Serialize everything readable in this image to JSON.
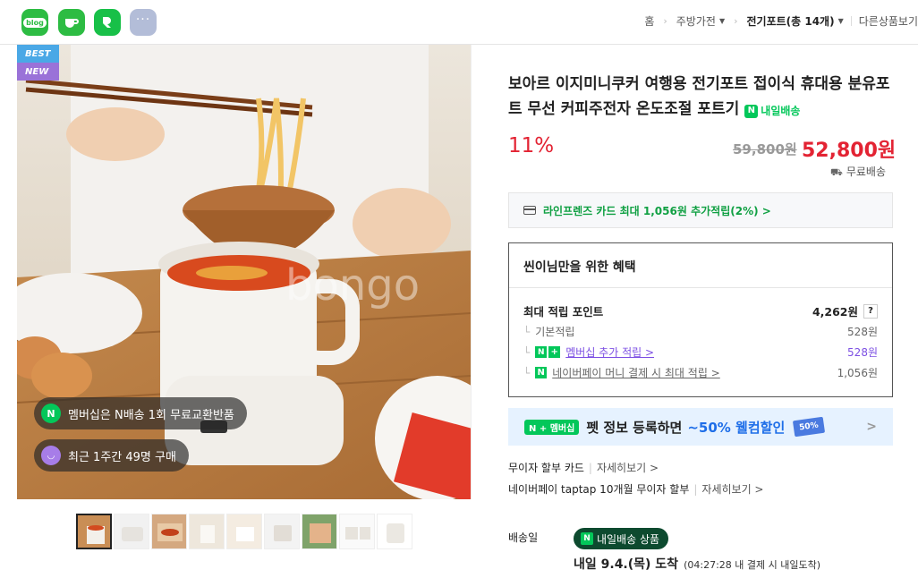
{
  "share": {
    "blog_label": "blog",
    "icons": [
      "blog-icon",
      "cafe-icon",
      "band-icon",
      "more-icon"
    ],
    "more_label": "···"
  },
  "breadcrumb": {
    "home": "홈",
    "category": "주방가전",
    "current": "전기포트(총 14개)",
    "other": "다른상품보기"
  },
  "image": {
    "badges": [
      "BEST",
      "NEW"
    ],
    "pill_membership": "멤버십은 N배송 1회 무료교환반품",
    "pill_recent": "최근 1주간 49명 구매",
    "pill_membership_icon": "N",
    "thumbnail_count": 9
  },
  "product": {
    "title": "보아르 이지미니쿠커 여행용 전기포트 접이식 휴대용 분유포트 무선 커피주전자 온도조절 포트기",
    "delivery_tag": "내일배송",
    "discount": "11%",
    "original_price": "59,800원",
    "price": "52,800원",
    "shipping": "무료배송"
  },
  "card_promo": "라인프렌즈 카드 최대 1,056원 추가적립(2%) >",
  "benefit": {
    "heading": "씬이님만을 위한 혜택",
    "max_points_label": "최대 적립 포인트",
    "max_points_value": "4,262원",
    "help": "?",
    "rows": [
      {
        "label": "기본적립",
        "value": "528원"
      },
      {
        "label": "멤버십 추가 적립 >",
        "value": "528원"
      },
      {
        "label": "네이버페이 머니 결제 시 최대 적립 >",
        "value": "1,056원"
      }
    ]
  },
  "banner": {
    "tag": "N + 멤버십",
    "text": "펫 정보 등록하면",
    "highlight": "~50% 웰컴할인",
    "coupon": "50%",
    "arrow": ">"
  },
  "installment": {
    "line1": "무이자 할부 카드",
    "line1_more": "자세히보기 >",
    "line2": "네이버페이 taptap 10개월 무이자 할부",
    "line2_more": "자세히보기 >"
  },
  "delivery": {
    "label": "배송일",
    "badge": "내일배송 상품",
    "date": "내일 9.4.(목) 도착",
    "note": "(04:27:28 내 결제 시 내일도착)"
  },
  "colors": {
    "naver_green": "#03c75a",
    "price_red": "#e32333",
    "membership_purple": "#7c4fe3",
    "banner_blue": "#1e6ee8"
  }
}
